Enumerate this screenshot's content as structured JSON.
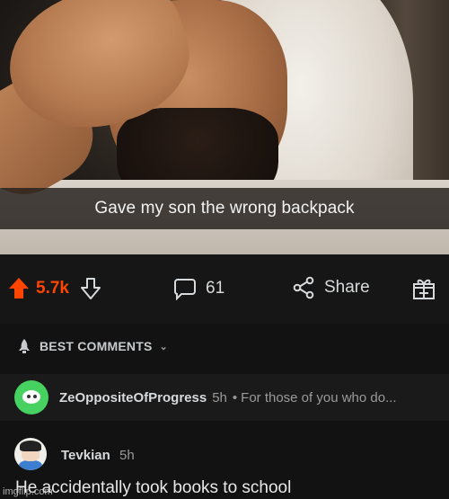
{
  "post": {
    "caption": "Gave my son the wrong backpack"
  },
  "actions": {
    "score": "5.7k",
    "comments_count": "61",
    "share_label": "Share",
    "upvote_color": "#ff4500"
  },
  "sort": {
    "label": "BEST COMMENTS"
  },
  "comments": [
    {
      "user": "ZeOppositeOfProgress",
      "time": "5h",
      "separator": "•",
      "preview": "For those of you who do..."
    },
    {
      "user": "Tevkian",
      "time": "5h",
      "body": "He accidentally took books to school"
    }
  ],
  "watermark": "imgflip.com"
}
